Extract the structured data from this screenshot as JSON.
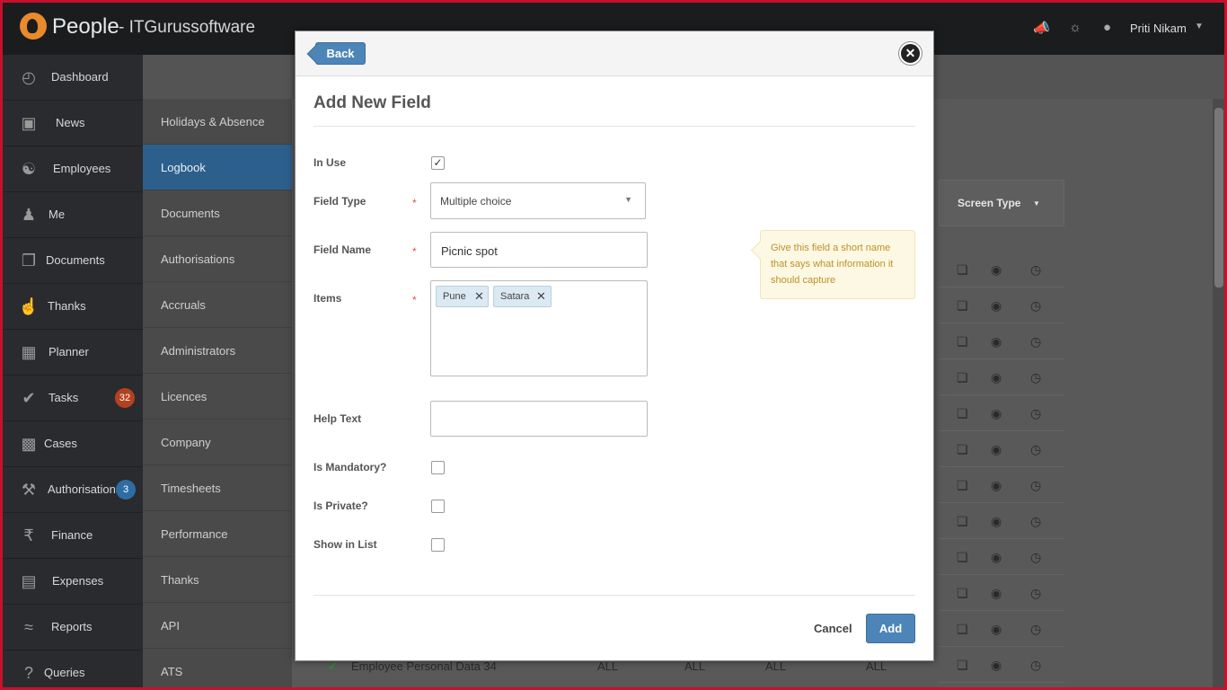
{
  "header": {
    "brand": "People",
    "company": "- ITGurussoftware",
    "user_name": "Priti Nikam"
  },
  "sidebar": {
    "items": [
      {
        "label": "Dashboard",
        "icon": "dashboard-icon"
      },
      {
        "label": "News",
        "icon": "tv-icon"
      },
      {
        "label": "Employees",
        "icon": "users-icon"
      },
      {
        "label": "Me",
        "icon": "user-icon"
      },
      {
        "label": "Documents",
        "icon": "documents-icon"
      },
      {
        "label": "Thanks",
        "icon": "thumbs-up-icon"
      },
      {
        "label": "Planner",
        "icon": "planner-icon"
      },
      {
        "label": "Tasks",
        "icon": "check-icon",
        "badge": "32"
      },
      {
        "label": "Cases",
        "icon": "folder-icon"
      },
      {
        "label": "Authorisations",
        "icon": "gavel-icon",
        "badge": "3"
      },
      {
        "label": "Finance",
        "icon": "finance-icon"
      },
      {
        "label": "Expenses",
        "icon": "wallet-icon"
      },
      {
        "label": "Reports",
        "icon": "chart-icon"
      },
      {
        "label": "Queries",
        "icon": "question-icon"
      }
    ]
  },
  "settings_nav": {
    "items": [
      "Holidays & Absence",
      "Logbook",
      "Documents",
      "Authorisations",
      "Accruals",
      "Administrators",
      "Licences",
      "Company",
      "Timesheets",
      "Performance",
      "Thanks",
      "API",
      "ATS"
    ],
    "active": "Logbook"
  },
  "background": {
    "column_header": "Screen Type",
    "bottom_row": {
      "name": "Employee Personal Data 34",
      "cols": [
        "ALL",
        "ALL",
        "ALL",
        "ALL"
      ]
    }
  },
  "modal": {
    "back_label": "Back",
    "title": "Add New Field",
    "in_use": {
      "label": "In Use",
      "checked": true
    },
    "field_type": {
      "label": "Field Type",
      "value": "Multiple choice"
    },
    "field_name": {
      "label": "Field Name",
      "value": "Picnic spot"
    },
    "items": {
      "label": "Items",
      "tags": [
        "Pune",
        "Satara"
      ]
    },
    "help_text": {
      "label": "Help Text",
      "value": ""
    },
    "is_mandatory": {
      "label": "Is Mandatory?",
      "checked": false
    },
    "is_private": {
      "label": "Is Private?",
      "checked": false
    },
    "show_in_list": {
      "label": "Show in List",
      "checked": false
    },
    "tooltip": "Give this field a short name that says what information it should capture",
    "required_mark": "*",
    "cancel_label": "Cancel",
    "add_label": "Add"
  },
  "colors": {
    "primary": "#4d85b8",
    "active_nav": "#2d5f8c",
    "required": "#d9534f",
    "tooltip_bg": "#fcf8e3"
  }
}
